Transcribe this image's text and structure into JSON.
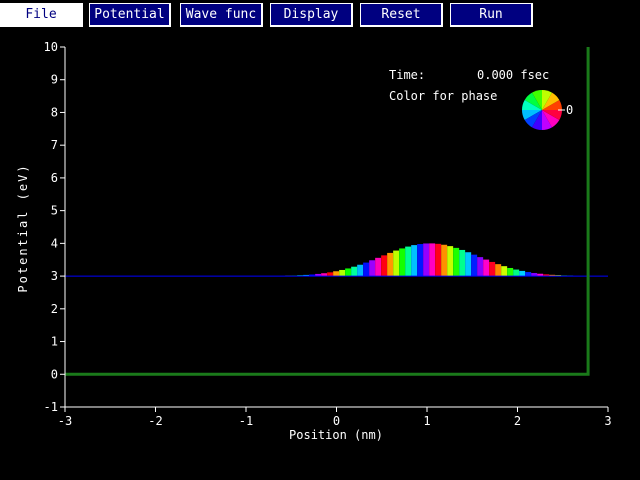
{
  "toolbar": {
    "buttons": [
      {
        "id": "file",
        "label": "File",
        "active": true
      },
      {
        "id": "potential",
        "label": "Potential",
        "active": false
      },
      {
        "id": "wave-func",
        "label": "Wave func",
        "active": false
      },
      {
        "id": "display",
        "label": "Display",
        "active": false
      },
      {
        "id": "reset",
        "label": "Reset",
        "active": false
      },
      {
        "id": "run",
        "label": "Run",
        "active": false
      }
    ]
  },
  "info": {
    "time_label": "Time:",
    "time_value": "0.000 fsec",
    "phase_label": "Color for phase",
    "phase_zero": "0"
  },
  "colors": {
    "axes": "#ffffff",
    "potential": "#1a7a1a",
    "baseline": "#0000ff",
    "button_bg": "#000080"
  },
  "chart_data": {
    "type": "line",
    "xlabel": "Position (nm)",
    "ylabel": "Potential (eV)",
    "xlim": [
      -3,
      3
    ],
    "ylim": [
      -1,
      10
    ],
    "xticks": [
      -3,
      -2,
      -1,
      0,
      1,
      2,
      3
    ],
    "yticks": [
      -1,
      0,
      1,
      2,
      3,
      4,
      5,
      6,
      7,
      8,
      9,
      10
    ],
    "potential": {
      "x": [
        -3,
        2.78,
        2.78
      ],
      "y": [
        0,
        0,
        10
      ]
    },
    "wavepacket": {
      "energy_baseline": 3,
      "center": 1.0,
      "amplitude": 1.0,
      "width": 0.75,
      "phase_wavelength": 0.6,
      "x_start": -0.7,
      "x_end": 2.75
    }
  }
}
